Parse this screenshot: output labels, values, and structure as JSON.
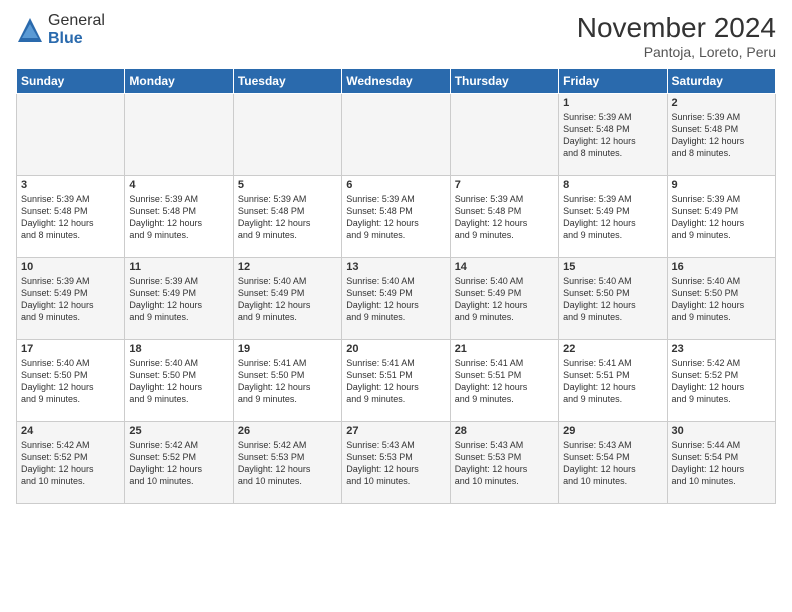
{
  "logo": {
    "general": "General",
    "blue": "Blue"
  },
  "title": "November 2024",
  "location": "Pantoja, Loreto, Peru",
  "days_of_week": [
    "Sunday",
    "Monday",
    "Tuesday",
    "Wednesday",
    "Thursday",
    "Friday",
    "Saturday"
  ],
  "weeks": [
    [
      {
        "day": "",
        "info": ""
      },
      {
        "day": "",
        "info": ""
      },
      {
        "day": "",
        "info": ""
      },
      {
        "day": "",
        "info": ""
      },
      {
        "day": "",
        "info": ""
      },
      {
        "day": "1",
        "info": "Sunrise: 5:39 AM\nSunset: 5:48 PM\nDaylight: 12 hours\nand 8 minutes."
      },
      {
        "day": "2",
        "info": "Sunrise: 5:39 AM\nSunset: 5:48 PM\nDaylight: 12 hours\nand 8 minutes."
      }
    ],
    [
      {
        "day": "3",
        "info": "Sunrise: 5:39 AM\nSunset: 5:48 PM\nDaylight: 12 hours\nand 8 minutes."
      },
      {
        "day": "4",
        "info": "Sunrise: 5:39 AM\nSunset: 5:48 PM\nDaylight: 12 hours\nand 9 minutes."
      },
      {
        "day": "5",
        "info": "Sunrise: 5:39 AM\nSunset: 5:48 PM\nDaylight: 12 hours\nand 9 minutes."
      },
      {
        "day": "6",
        "info": "Sunrise: 5:39 AM\nSunset: 5:48 PM\nDaylight: 12 hours\nand 9 minutes."
      },
      {
        "day": "7",
        "info": "Sunrise: 5:39 AM\nSunset: 5:48 PM\nDaylight: 12 hours\nand 9 minutes."
      },
      {
        "day": "8",
        "info": "Sunrise: 5:39 AM\nSunset: 5:49 PM\nDaylight: 12 hours\nand 9 minutes."
      },
      {
        "day": "9",
        "info": "Sunrise: 5:39 AM\nSunset: 5:49 PM\nDaylight: 12 hours\nand 9 minutes."
      }
    ],
    [
      {
        "day": "10",
        "info": "Sunrise: 5:39 AM\nSunset: 5:49 PM\nDaylight: 12 hours\nand 9 minutes."
      },
      {
        "day": "11",
        "info": "Sunrise: 5:39 AM\nSunset: 5:49 PM\nDaylight: 12 hours\nand 9 minutes."
      },
      {
        "day": "12",
        "info": "Sunrise: 5:40 AM\nSunset: 5:49 PM\nDaylight: 12 hours\nand 9 minutes."
      },
      {
        "day": "13",
        "info": "Sunrise: 5:40 AM\nSunset: 5:49 PM\nDaylight: 12 hours\nand 9 minutes."
      },
      {
        "day": "14",
        "info": "Sunrise: 5:40 AM\nSunset: 5:49 PM\nDaylight: 12 hours\nand 9 minutes."
      },
      {
        "day": "15",
        "info": "Sunrise: 5:40 AM\nSunset: 5:50 PM\nDaylight: 12 hours\nand 9 minutes."
      },
      {
        "day": "16",
        "info": "Sunrise: 5:40 AM\nSunset: 5:50 PM\nDaylight: 12 hours\nand 9 minutes."
      }
    ],
    [
      {
        "day": "17",
        "info": "Sunrise: 5:40 AM\nSunset: 5:50 PM\nDaylight: 12 hours\nand 9 minutes."
      },
      {
        "day": "18",
        "info": "Sunrise: 5:40 AM\nSunset: 5:50 PM\nDaylight: 12 hours\nand 9 minutes."
      },
      {
        "day": "19",
        "info": "Sunrise: 5:41 AM\nSunset: 5:50 PM\nDaylight: 12 hours\nand 9 minutes."
      },
      {
        "day": "20",
        "info": "Sunrise: 5:41 AM\nSunset: 5:51 PM\nDaylight: 12 hours\nand 9 minutes."
      },
      {
        "day": "21",
        "info": "Sunrise: 5:41 AM\nSunset: 5:51 PM\nDaylight: 12 hours\nand 9 minutes."
      },
      {
        "day": "22",
        "info": "Sunrise: 5:41 AM\nSunset: 5:51 PM\nDaylight: 12 hours\nand 9 minutes."
      },
      {
        "day": "23",
        "info": "Sunrise: 5:42 AM\nSunset: 5:52 PM\nDaylight: 12 hours\nand 9 minutes."
      }
    ],
    [
      {
        "day": "24",
        "info": "Sunrise: 5:42 AM\nSunset: 5:52 PM\nDaylight: 12 hours\nand 10 minutes."
      },
      {
        "day": "25",
        "info": "Sunrise: 5:42 AM\nSunset: 5:52 PM\nDaylight: 12 hours\nand 10 minutes."
      },
      {
        "day": "26",
        "info": "Sunrise: 5:42 AM\nSunset: 5:53 PM\nDaylight: 12 hours\nand 10 minutes."
      },
      {
        "day": "27",
        "info": "Sunrise: 5:43 AM\nSunset: 5:53 PM\nDaylight: 12 hours\nand 10 minutes."
      },
      {
        "day": "28",
        "info": "Sunrise: 5:43 AM\nSunset: 5:53 PM\nDaylight: 12 hours\nand 10 minutes."
      },
      {
        "day": "29",
        "info": "Sunrise: 5:43 AM\nSunset: 5:54 PM\nDaylight: 12 hours\nand 10 minutes."
      },
      {
        "day": "30",
        "info": "Sunrise: 5:44 AM\nSunset: 5:54 PM\nDaylight: 12 hours\nand 10 minutes."
      }
    ]
  ]
}
